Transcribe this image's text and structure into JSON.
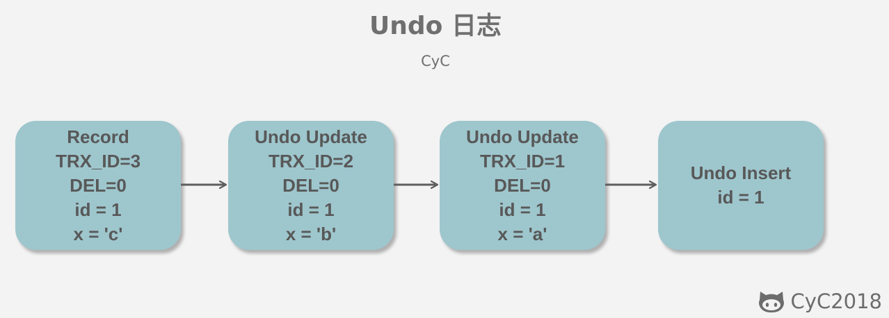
{
  "diagram": {
    "title": "Undo 日志",
    "subtitle": "CyC",
    "nodes": [
      {
        "id": "record",
        "lines": [
          "Record",
          "TRX_ID=3",
          "DEL=0",
          "id = 1",
          "x = 'c'"
        ]
      },
      {
        "id": "undo-update-2",
        "lines": [
          "Undo Update",
          "TRX_ID=2",
          "DEL=0",
          "id = 1",
          "x = 'b'"
        ]
      },
      {
        "id": "undo-update-1",
        "lines": [
          "Undo Update",
          "TRX_ID=1",
          "DEL=0",
          "id = 1",
          "x = 'a'"
        ]
      },
      {
        "id": "undo-insert",
        "lines": [
          "Undo Insert",
          "id = 1"
        ]
      }
    ],
    "edges": [
      {
        "from": "record",
        "to": "undo-update-2"
      },
      {
        "from": "undo-update-2",
        "to": "undo-update-1"
      },
      {
        "from": "undo-update-1",
        "to": "undo-insert"
      }
    ],
    "colors": {
      "node_fill": "#9ec6cd",
      "node_text": "#585858",
      "arrow": "#5e5e5e",
      "background": "#f3f3f3"
    }
  },
  "watermark": {
    "text": "CyC2018",
    "icon": "github-octocat-icon"
  }
}
